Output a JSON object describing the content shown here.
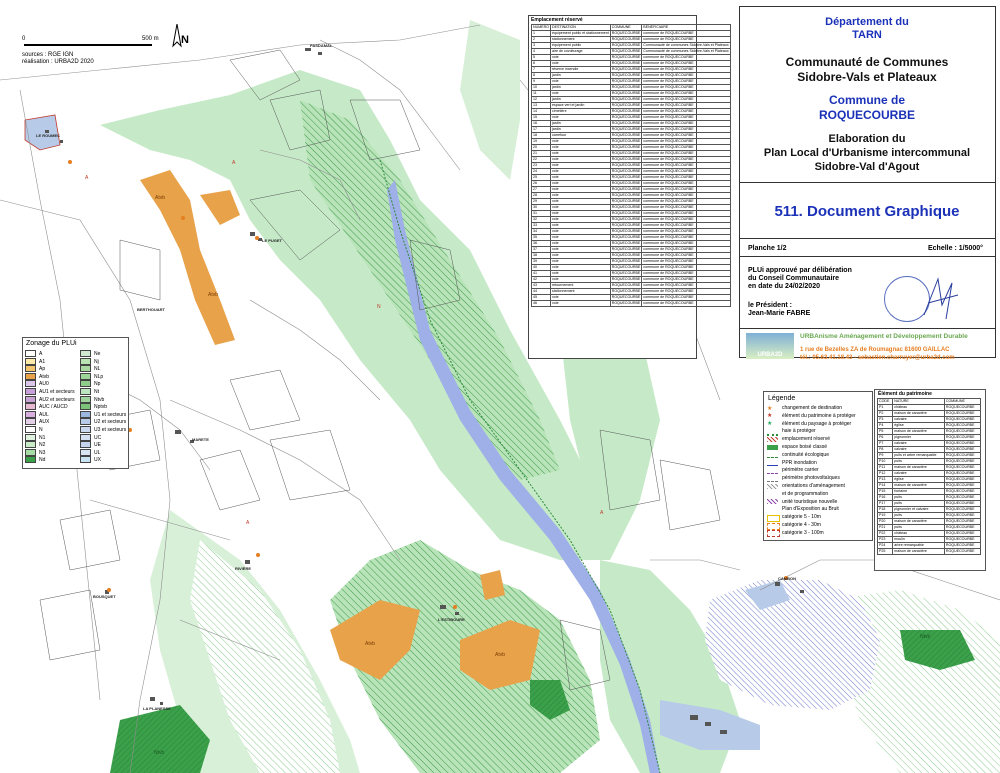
{
  "scale_bar": {
    "zero": "0",
    "end": "500 m"
  },
  "north": "N",
  "sources": {
    "line1": "sources : RGE IGN",
    "line2": "réalisation : URBA2D 2020"
  },
  "emplacement": {
    "title": "Emplacement réservé",
    "headers": [
      "NUMÉRO",
      "DESTINATION",
      "COMMUNE",
      "BÉNÉFICIAIRE"
    ],
    "rows": [
      [
        "1",
        "équipement public et stationnement",
        "ROQUECOURBE",
        "commune de ROQUECOURBE"
      ],
      [
        "2",
        "stationnement",
        "ROQUECOURBE",
        "commune de ROQUECOURBE"
      ],
      [
        "3",
        "équipement public",
        "ROQUECOURBE",
        "Communauté de communes Sidobre-Vals et Plateaux"
      ],
      [
        "4",
        "aire de covoiturage",
        "ROQUECOURBE",
        "Communauté de communes Sidobre-Vals et Plateaux"
      ],
      [
        "5",
        "voie",
        "ROQUECOURBE",
        "commune de ROQUECOURBE"
      ],
      [
        "6",
        "voie",
        "ROQUECOURBE",
        "commune de ROQUECOURBE"
      ],
      [
        "7",
        "réserve incendie",
        "ROQUECOURBE",
        "commune de ROQUECOURBE"
      ],
      [
        "8",
        "jardin",
        "ROQUECOURBE",
        "commune de ROQUECOURBE"
      ],
      [
        "9",
        "voie",
        "ROQUECOURBE",
        "commune de ROQUECOURBE"
      ],
      [
        "10",
        "jardin",
        "ROQUECOURBE",
        "commune de ROQUECOURBE"
      ],
      [
        "11",
        "voie",
        "ROQUECOURBE",
        "commune de ROQUECOURBE"
      ],
      [
        "12",
        "jardin",
        "ROQUECOURBE",
        "commune de ROQUECOURBE"
      ],
      [
        "13",
        "espace vert et jardin",
        "ROQUECOURBE",
        "commune de ROQUECOURBE"
      ],
      [
        "14",
        "cimetière",
        "ROQUECOURBE",
        "commune de ROQUECOURBE"
      ],
      [
        "15",
        "voie",
        "ROQUECOURBE",
        "commune de ROQUECOURBE"
      ],
      [
        "16",
        "jardin",
        "ROQUECOURBE",
        "commune de ROQUECOURBE"
      ],
      [
        "17",
        "jardin",
        "ROQUECOURBE",
        "commune de ROQUECOURBE"
      ],
      [
        "18",
        "carrefour",
        "ROQUECOURBE",
        "commune de ROQUECOURBE"
      ],
      [
        "19",
        "voie",
        "ROQUECOURBE",
        "commune de ROQUECOURBE"
      ],
      [
        "20",
        "voie",
        "ROQUECOURBE",
        "commune de ROQUECOURBE"
      ],
      [
        "21",
        "voie",
        "ROQUECOURBE",
        "commune de ROQUECOURBE"
      ],
      [
        "22",
        "voie",
        "ROQUECOURBE",
        "commune de ROQUECOURBE"
      ],
      [
        "23",
        "voie",
        "ROQUECOURBE",
        "commune de ROQUECOURBE"
      ],
      [
        "24",
        "voie",
        "ROQUECOURBE",
        "commune de ROQUECOURBE"
      ],
      [
        "25",
        "voie",
        "ROQUECOURBE",
        "commune de ROQUECOURBE"
      ],
      [
        "26",
        "voie",
        "ROQUECOURBE",
        "commune de ROQUECOURBE"
      ],
      [
        "27",
        "voie",
        "ROQUECOURBE",
        "commune de ROQUECOURBE"
      ],
      [
        "28",
        "voie",
        "ROQUECOURBE",
        "commune de ROQUECOURBE"
      ],
      [
        "29",
        "voie",
        "ROQUECOURBE",
        "commune de ROQUECOURBE"
      ],
      [
        "30",
        "voie",
        "ROQUECOURBE",
        "commune de ROQUECOURBE"
      ],
      [
        "31",
        "voie",
        "ROQUECOURBE",
        "commune de ROQUECOURBE"
      ],
      [
        "32",
        "voie",
        "ROQUECOURBE",
        "commune de ROQUECOURBE"
      ],
      [
        "33",
        "voie",
        "ROQUECOURBE",
        "commune de ROQUECOURBE"
      ],
      [
        "34",
        "voie",
        "ROQUECOURBE",
        "commune de ROQUECOURBE"
      ],
      [
        "35",
        "voie",
        "ROQUECOURBE",
        "commune de ROQUECOURBE"
      ],
      [
        "36",
        "voie",
        "ROQUECOURBE",
        "commune de ROQUECOURBE"
      ],
      [
        "37",
        "voie",
        "ROQUECOURBE",
        "commune de ROQUECOURBE"
      ],
      [
        "38",
        "voie",
        "ROQUECOURBE",
        "commune de ROQUECOURBE"
      ],
      [
        "39",
        "voie",
        "ROQUECOURBE",
        "commune de ROQUECOURBE"
      ],
      [
        "40",
        "voie",
        "ROQUECOURBE",
        "commune de ROQUECOURBE"
      ],
      [
        "41",
        "voie",
        "ROQUECOURBE",
        "commune de ROQUECOURBE"
      ],
      [
        "42",
        "voie",
        "ROQUECOURBE",
        "commune de ROQUECOURBE"
      ],
      [
        "43",
        "retournement",
        "ROQUECOURBE",
        "commune de ROQUECOURBE"
      ],
      [
        "44",
        "stationnement",
        "ROQUECOURBE",
        "commune de ROQUECOURBE"
      ],
      [
        "45",
        "voie",
        "ROQUECOURBE",
        "commune de ROQUECOURBE"
      ],
      [
        "46",
        "voie",
        "ROQUECOURBE",
        "commune de ROQUECOURBE"
      ]
    ]
  },
  "title_block": {
    "departement_1": "Département du",
    "departement_2": "TARN",
    "cc_1": "Communauté de Communes",
    "cc_2": "Sidobre-Vals et Plateaux",
    "commune_1": "Commune de",
    "commune_2": "ROQUECOURBE",
    "elab_1": "Elaboration du",
    "elab_2": "Plan Local d'Urbanisme intercommunal",
    "elab_3": "Sidobre-Val d'Agout",
    "doc_title": "511. Document Graphique",
    "planche": "Planche 1/2",
    "echelle": "Echelle : 1/5000°",
    "approval_1": "PLUi approuvé par délibération",
    "approval_2": "du Conseil Communautaire",
    "approval_3": "en date du 24/02/2020",
    "president_1": "le Président :",
    "president_2": "Jean-Marie FABRE",
    "urba_name": "URBAnisme Aménagement et Développement Durable",
    "urba_logo": "URBA2D",
    "urba_addr": "1 rue de Bezelles  ZA de Roumagnac  81600 GAILLAC",
    "urba_contact": "tél.: 05.63.41.18.43 - sebastien.charruyer@urba2d.com"
  },
  "zonage": {
    "title": "Zonage du PLUi",
    "left": [
      {
        "label": "A",
        "color": "#ffffff"
      },
      {
        "label": "A1",
        "color": "#fde9a8"
      },
      {
        "label": "Ap",
        "color": "#f3c46e"
      },
      {
        "label": "Atvb",
        "color": "#e8a24a"
      },
      {
        "label": "AU0",
        "color": "#d9c6e8"
      },
      {
        "label": "AU1 et secteurs",
        "color": "#c8a0d8"
      },
      {
        "label": "AU2 et secteurs",
        "color": "#c9a2d4"
      },
      {
        "label": "AUC / AUCD",
        "color": "#e6b8d2"
      },
      {
        "label": "AUL",
        "color": "#d7b0e0"
      },
      {
        "label": "AUX",
        "color": "#e4cfe8"
      },
      {
        "label": "N",
        "color": "#ffffff"
      },
      {
        "label": "N1",
        "color": "#e0f3e0"
      },
      {
        "label": "N2",
        "color": "#c8ebc8"
      },
      {
        "label": "N3",
        "color": "#a7dca7"
      },
      {
        "label": "Nd",
        "color": "#3aa04a"
      }
    ],
    "right": [
      {
        "label": "Ne",
        "color": "#cfe8cf"
      },
      {
        "label": "Nj",
        "color": "#b9e3b0"
      },
      {
        "label": "NL",
        "color": "#a9d8a0"
      },
      {
        "label": "NLp",
        "color": "#9ed59a"
      },
      {
        "label": "Np",
        "color": "#8fce8a"
      },
      {
        "label": "Nt",
        "color": "#bde6c0"
      },
      {
        "label": "Ntvb",
        "color": "#9fd49e"
      },
      {
        "label": "Nptvb",
        "color": "#7cc47a"
      },
      {
        "label": "U1 et secteurs",
        "color": "#9bb7e0"
      },
      {
        "label": "U2 et secteurs",
        "color": "#b7cbe9"
      },
      {
        "label": "U3 et secteurs",
        "color": "#cad8ef"
      },
      {
        "label": "UC",
        "color": "#d4e0f2"
      },
      {
        "label": "UE",
        "color": "#c4d4ec"
      },
      {
        "label": "UL",
        "color": "#d6e4f4"
      },
      {
        "label": "UX",
        "color": "#c8e4f4"
      }
    ]
  },
  "legende": {
    "title": "Légende",
    "items": [
      {
        "label": "changement de destination",
        "icon": "star-orange"
      },
      {
        "label": "élément du patrimoine à protéger",
        "icon": "star-red"
      },
      {
        "label": "élément du paysage à protéger",
        "icon": "star-green"
      },
      {
        "label": "haie à protéger",
        "icon": "hedge-dots"
      },
      {
        "label": "emplacement réservé",
        "icon": "hatch-red"
      },
      {
        "label": "espace boisé classé",
        "icon": "circles-green"
      },
      {
        "label": "continuité écologique",
        "icon": "line-green"
      },
      {
        "label": "PPR inondation",
        "icon": "line-blue"
      },
      {
        "label": "périmètre carrier",
        "icon": "dash-purple"
      },
      {
        "label": "périmètre photovoltaïques",
        "icon": "dash-grey"
      },
      {
        "label": "orientations d'aménagement",
        "icon": "hatch-grey"
      },
      {
        "label": "et de programmation",
        "icon": ""
      },
      {
        "label": "unité touristique nouvelle",
        "icon": "hatch-purple"
      },
      {
        "label": "Plan d'Exposition au Bruit",
        "icon": ""
      },
      {
        "label": "catégorie 5 - 10m",
        "icon": "box-yellow"
      },
      {
        "label": "catégorie 4 - 30m",
        "icon": "box-orange"
      },
      {
        "label": "catégorie 3 - 100m",
        "icon": "box-red"
      }
    ]
  },
  "patrimoine": {
    "title": "Élément du patrimoine",
    "headers": [
      "CODE",
      "NATURE",
      "COMMUNE"
    ],
    "rows": [
      [
        "P1",
        "château",
        "ROQUECOURBE"
      ],
      [
        "P2",
        "maison de caractère",
        "ROQUECOURBE"
      ],
      [
        "P3",
        "calvaire",
        "ROQUECOURBE"
      ],
      [
        "P4",
        "église",
        "ROQUECOURBE"
      ],
      [
        "P5",
        "maison de caractère",
        "ROQUECOURBE"
      ],
      [
        "P6",
        "pigeonnier",
        "ROQUECOURBE"
      ],
      [
        "P7",
        "calvaire",
        "ROQUECOURBE"
      ],
      [
        "P8",
        "calvaire",
        "ROQUECOURBE"
      ],
      [
        "P9",
        "puits et arbre remarquable",
        "ROQUECOURBE"
      ],
      [
        "P10",
        "puits",
        "ROQUECOURBE"
      ],
      [
        "P11",
        "maison de caractère",
        "ROQUECOURBE"
      ],
      [
        "P12",
        "calvaire",
        "ROQUECOURBE"
      ],
      [
        "P13",
        "église",
        "ROQUECOURBE"
      ],
      [
        "P14",
        "maison de caractère",
        "ROQUECOURBE"
      ],
      [
        "P15",
        "fontaine",
        "ROQUECOURBE"
      ],
      [
        "P16",
        "puits",
        "ROQUECOURBE"
      ],
      [
        "P17",
        "puits",
        "ROQUECOURBE"
      ],
      [
        "P18",
        "pigeonnier et calvaire",
        "ROQUECOURBE"
      ],
      [
        "P19",
        "puits",
        "ROQUECOURBE"
      ],
      [
        "P20",
        "maison de caractère",
        "ROQUECOURBE"
      ],
      [
        "P21",
        "puits",
        "ROQUECOURBE"
      ],
      [
        "P22",
        "château",
        "ROQUECOURBE"
      ],
      [
        "P23",
        "moulin",
        "ROQUECOURBE"
      ],
      [
        "P24",
        "arbre remarquable",
        "ROQUECOURBE"
      ],
      [
        "P25",
        "maison de caractère",
        "ROQUECOURBE"
      ]
    ]
  },
  "map_labels": {
    "pasdamal": "PASDAMAL",
    "roumec": "LE ROUMEC",
    "puget": "LE PUGET",
    "berthouart": "BERTHOUART",
    "marete": "MARETE",
    "riviere": "RIVIÈRE",
    "bousquet": "BOUSQUET",
    "estiboure": "L'ESTIBOURE",
    "planesse": "LA PLANESSE",
    "cambon": "CAMBON",
    "zone_A": "A",
    "zone_N": "N",
    "zone_Atvb": "Atvb",
    "zone_Ntvb": "Ntvb"
  }
}
